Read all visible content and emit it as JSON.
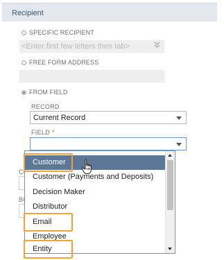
{
  "section": {
    "title": "Recipient"
  },
  "options": {
    "specific_recipient": "SPECIFIC RECIPIENT",
    "free_form_address": "FREE FORM ADDRESS",
    "from_field": "FROM FIELD"
  },
  "specific_recipient_input": {
    "placeholder": "<Enter first few letters then tab>"
  },
  "record": {
    "label": "RECORD",
    "value": "Current Record"
  },
  "field": {
    "label": "FIELD",
    "required_mark": "*",
    "value": ""
  },
  "side_labels": {
    "cc": "CC",
    "bcc": "BCC"
  },
  "dropdown": {
    "items": [
      "Customer",
      "Customer (Payments and Deposits)",
      "Decision Maker",
      "Distributor",
      "Email",
      "Employee",
      "Entity"
    ],
    "selected": "Customer",
    "highlighted": [
      "Customer",
      "Email",
      "Entity"
    ]
  },
  "colors": {
    "highlight_box": "#f0a23c",
    "selected_option": "#5c7896",
    "header_bg": "#e2e8ee",
    "header_text": "#3d5670"
  },
  "icons": {
    "cursor": "hand-pointer-icon",
    "double_chevron": "double-chevron-down-icon"
  }
}
